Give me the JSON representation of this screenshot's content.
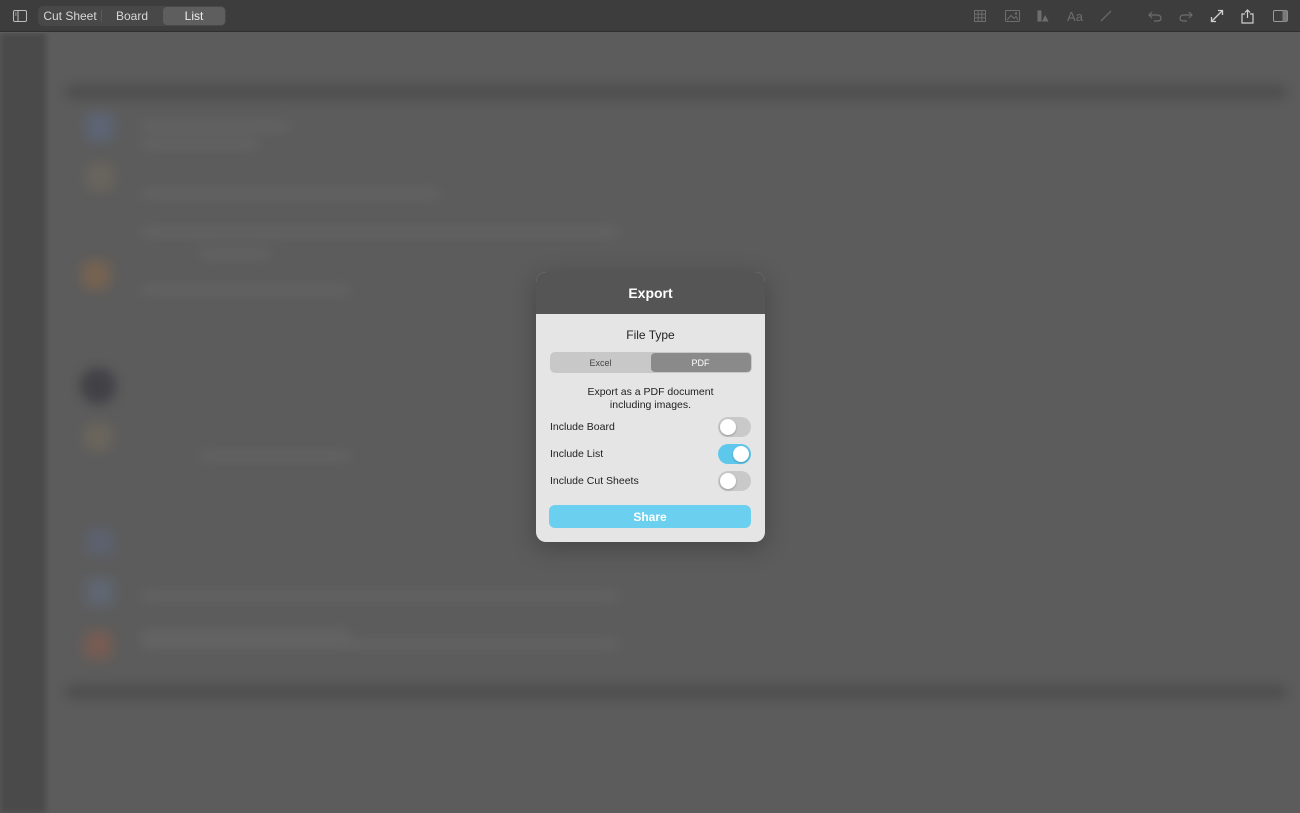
{
  "toolbar": {
    "tabs": [
      {
        "label": "Cut Sheet",
        "active": false
      },
      {
        "label": "Board",
        "active": false
      },
      {
        "label": "List",
        "active": true
      }
    ],
    "icons": {
      "sidebar_toggle": "sidebar-left-icon",
      "grid": "grid-icon",
      "image": "image-icon",
      "shapes": "shapes-icon",
      "text": "Aa",
      "pen": "pen-icon",
      "undo": "undo-icon",
      "redo": "redo-icon",
      "expand": "expand-icon",
      "share": "share-icon",
      "inspector": "sidebar-right-icon"
    }
  },
  "dialog": {
    "title": "Export",
    "file_type_label": "File Type",
    "file_types": [
      {
        "label": "Excel",
        "selected": false
      },
      {
        "label": "PDF",
        "selected": true
      }
    ],
    "description_line1": "Export as a PDF document",
    "description_line2": "including images.",
    "options": [
      {
        "label": "Include Board",
        "enabled": false
      },
      {
        "label": "Include List",
        "enabled": true
      },
      {
        "label": "Include Cut Sheets",
        "enabled": false
      }
    ],
    "share_label": "Share"
  },
  "colors": {
    "accent": "#5ec8ec",
    "share_button": "#6bd0ef",
    "dialog_header": "#555555",
    "toolbar": "#3d3d3d",
    "overlay": "#5c5c5c"
  }
}
